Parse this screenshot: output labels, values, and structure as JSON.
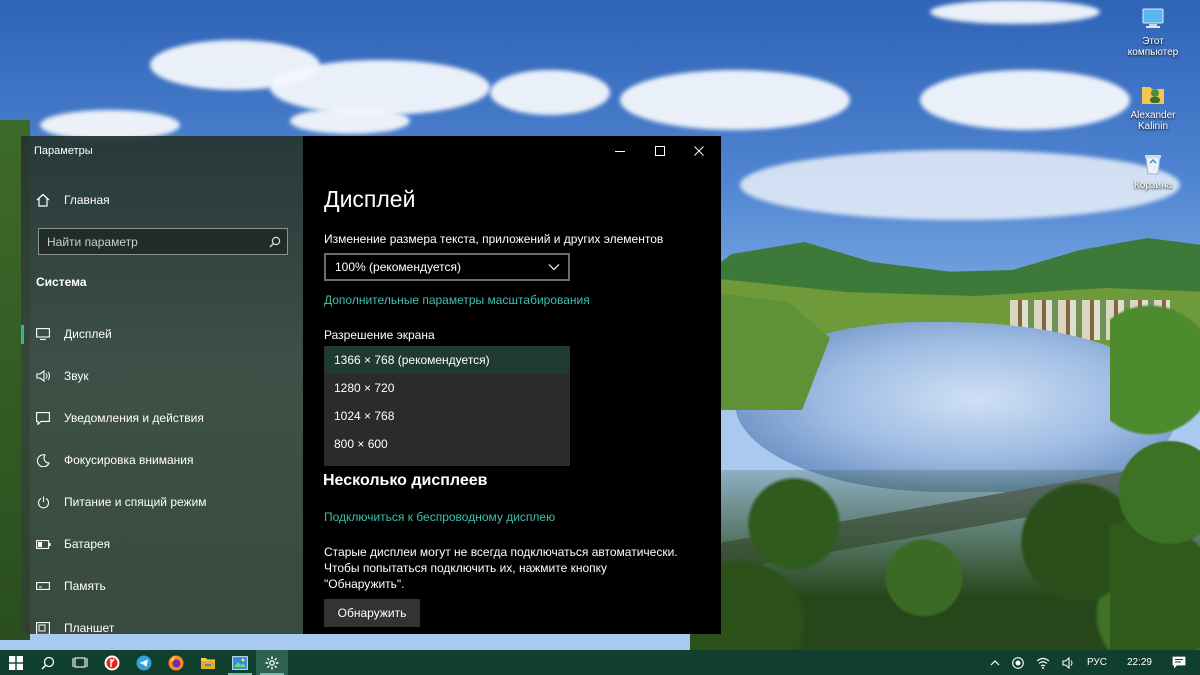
{
  "window": {
    "title": "Параметры",
    "controls": {
      "minimize": "minimize-icon",
      "maximize": "maximize-icon",
      "close": "close-icon"
    }
  },
  "sidebar": {
    "home_label": "Главная",
    "search_placeholder": "Найти параметр",
    "section_title": "Система",
    "items": [
      {
        "label": "Дисплей",
        "icon": "monitor-icon",
        "active": true
      },
      {
        "label": "Звук",
        "icon": "speaker-icon"
      },
      {
        "label": "Уведомления и действия",
        "icon": "notification-icon"
      },
      {
        "label": "Фокусировка внимания",
        "icon": "moon-icon"
      },
      {
        "label": "Питание и спящий режим",
        "icon": "power-icon"
      },
      {
        "label": "Батарея",
        "icon": "battery-icon"
      },
      {
        "label": "Память",
        "icon": "storage-icon"
      },
      {
        "label": "Планшет",
        "icon": "tablet-icon"
      }
    ]
  },
  "content": {
    "title": "Дисплей",
    "scale_label": "Изменение размера текста, приложений и других элементов",
    "scale_value": "100% (рекомендуется)",
    "scale_link": "Дополнительные параметры масштабирования",
    "resolution_label": "Разрешение экрана",
    "resolution_options": [
      "1366 × 768 (рекомендуется)",
      "1280 × 720",
      "1024 × 768",
      "800 × 600"
    ],
    "resolution_selected_index": 0,
    "multi_display_title": "Несколько дисплеев",
    "wireless_link": "Подключиться к беспроводному дисплею",
    "detect_text_1": "Старые дисплеи могут не всегда подключаться автоматически.",
    "detect_text_2": "Чтобы попытаться подключить их, нажмите кнопку",
    "detect_text_3": "\"Обнаружить\".",
    "detect_button": "Обнаружить"
  },
  "desktop_icons": [
    {
      "label_1": "Этот",
      "label_2": "компьютер",
      "icon": "this-pc-icon"
    },
    {
      "label_1": "Alexander",
      "label_2": "Kalinin",
      "icon": "user-folder-icon"
    },
    {
      "label_1": "Корзина",
      "label_2": "",
      "icon": "recycle-bin-icon"
    }
  ],
  "taskbar": {
    "apps": [
      "windows-start-icon",
      "search-icon",
      "task-view-icon",
      "yandex-browser-icon",
      "telegram-icon",
      "firefox-icon",
      "file-explorer-icon",
      "image-viewer-icon",
      "settings-gear-icon"
    ],
    "language": "РУС",
    "time": "22:29"
  },
  "colors": {
    "accent": "#3cc0a9",
    "taskbar": "#103f2e",
    "content_bg": "#000000"
  }
}
